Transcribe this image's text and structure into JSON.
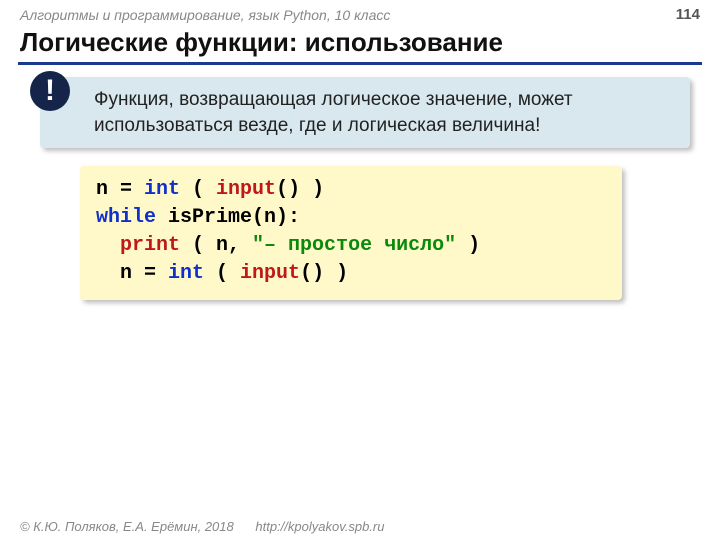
{
  "header": {
    "course": "Алгоритмы и программирование, язык Python, 10 класс",
    "page": "114"
  },
  "title": "Логические функции: использование",
  "note": {
    "bang": "!",
    "text": "Функция, возвращающая логическое значение, может использоваться везде, где и логическая величина!"
  },
  "code": {
    "l1a": "n = ",
    "l1b": "int",
    "l1c": " ( ",
    "l1d": "input",
    "l1e": "() )",
    "l2a": "while",
    "l2b": " isPrime(n):",
    "l3a": "  ",
    "l3b": "print",
    "l3c": " ( n, ",
    "l3d": "\"– простое число\"",
    "l3e": " )",
    "l4a": "  n = ",
    "l4b": "int",
    "l4c": " ( ",
    "l4d": "input",
    "l4e": "() )"
  },
  "footer": {
    "copyright": "© К.Ю. Поляков, Е.А. Ерёмин, 2018",
    "url": "http://kpolyakov.spb.ru"
  }
}
